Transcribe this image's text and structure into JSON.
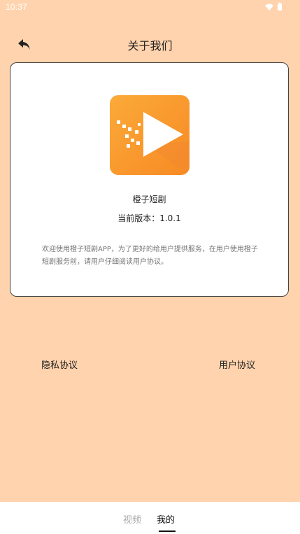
{
  "status_bar": {
    "time": "10:37"
  },
  "header": {
    "title": "关于我们"
  },
  "about": {
    "app_name": "橙子短剧",
    "version": "当前版本：1.0.1",
    "description": "欢迎使用橙子短剧APP，为了更好的给用户提供服务，在用户使用橙子短剧服务前，请用户仔细阅读用户协议。"
  },
  "links": {
    "privacy": "隐私协议",
    "user_agreement": "用户协议"
  },
  "bottom_nav": {
    "tabs": [
      {
        "label": "视频",
        "active": false
      },
      {
        "label": "我的",
        "active": true
      }
    ]
  },
  "colors": {
    "background": "#FFD3AD",
    "logo_orange": "#F99A2E"
  }
}
